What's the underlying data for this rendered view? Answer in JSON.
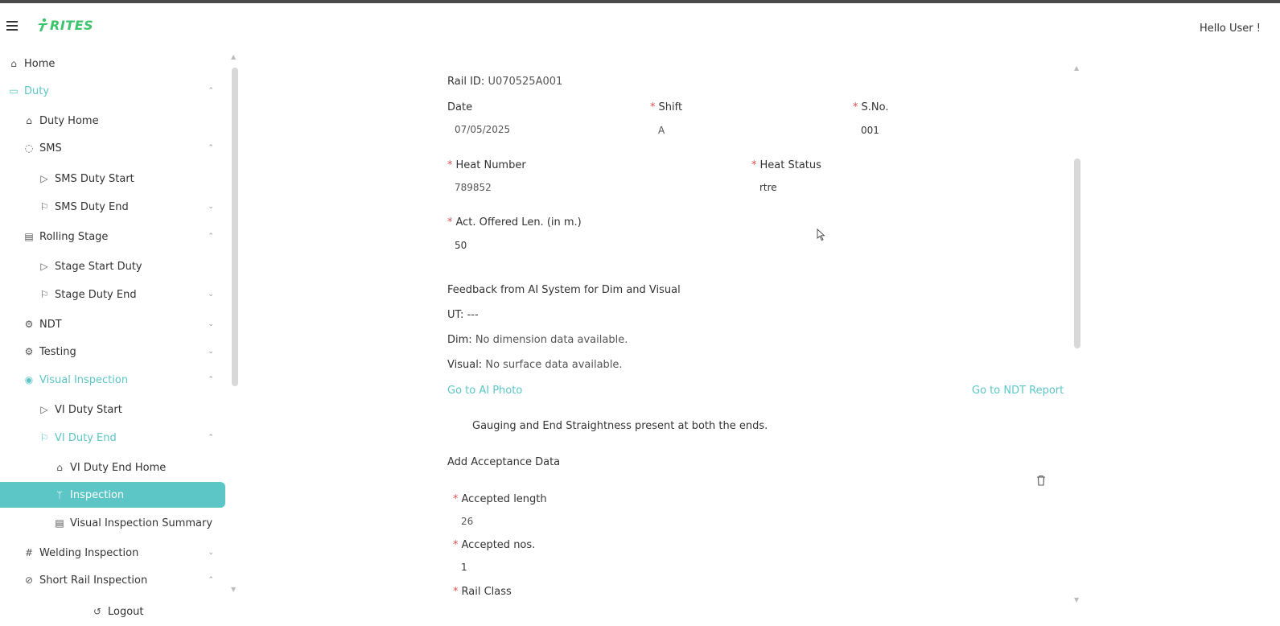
{
  "header": {
    "logo_text": "RITES",
    "greeting": "Hello User !",
    "menu_icon": "hamburger-icon"
  },
  "sidebar": {
    "items": [
      {
        "label": "Home",
        "icon": "home-icon"
      },
      {
        "label": "Duty",
        "icon": "duty-icon"
      },
      {
        "label": "Duty Home",
        "icon": "bank-icon"
      },
      {
        "label": "SMS",
        "icon": "chat-icon"
      },
      {
        "label": "SMS Duty Start",
        "icon": "send-icon"
      },
      {
        "label": "SMS Duty End",
        "icon": "flag-icon"
      },
      {
        "label": "Rolling Stage",
        "icon": "file-search-icon"
      },
      {
        "label": "Stage Start Duty",
        "icon": "send-icon"
      },
      {
        "label": "Stage Duty End",
        "icon": "flag-icon"
      },
      {
        "label": "NDT",
        "icon": "gear-icon"
      },
      {
        "label": "Testing",
        "icon": "gear-icon"
      },
      {
        "label": "Visual Inspection",
        "icon": "eye-icon"
      },
      {
        "label": "VI Duty Start",
        "icon": "send-icon"
      },
      {
        "label": "VI Duty End",
        "icon": "flag-icon"
      },
      {
        "label": "VI Duty End Home",
        "icon": "bank-icon"
      },
      {
        "label": "Inspection",
        "icon": "branch-icon"
      },
      {
        "label": "Visual Inspection Summary",
        "icon": "file-search-icon"
      },
      {
        "label": "Welding Inspection",
        "icon": "number-icon"
      },
      {
        "label": "Short Rail Inspection",
        "icon": "compass-icon"
      },
      {
        "label": "Logout",
        "icon": "logout-icon"
      }
    ]
  },
  "form": {
    "rail_id_label": "Rail ID:",
    "rail_id_value": "U070525A001",
    "date_label": "Date",
    "date_value": "07/05/2025",
    "shift_label": "Shift",
    "shift_value": "A",
    "sno_label": "S.No.",
    "sno_value": "001",
    "heat_number_label": "Heat Number",
    "heat_number_value": "789852",
    "heat_status_label": "Heat Status",
    "heat_status_value": "rtre",
    "offered_len_label": "Act. Offered Len. (in m.)",
    "offered_len_value": "50",
    "ai_feedback_title": "Feedback from AI System for Dim and Visual",
    "ut_label": "UT:",
    "ut_value": "---",
    "dim_label": "Dim:",
    "dim_value": "No dimension data available.",
    "visual_label": "Visual:",
    "visual_value": "No surface data available.",
    "ai_photo_link": "Go to AI Photo",
    "ndt_report_link": "Go to NDT Report",
    "gauging_note": "Gauging and End Straightness present at both the ends.",
    "acceptance_title": "Add Acceptance Data",
    "accepted_length_label": "Accepted length",
    "accepted_length_value": "26",
    "accepted_nos_label": "Accepted nos.",
    "accepted_nos_value": "1",
    "rail_class_label": "Rail Class",
    "required_mark": "*"
  }
}
